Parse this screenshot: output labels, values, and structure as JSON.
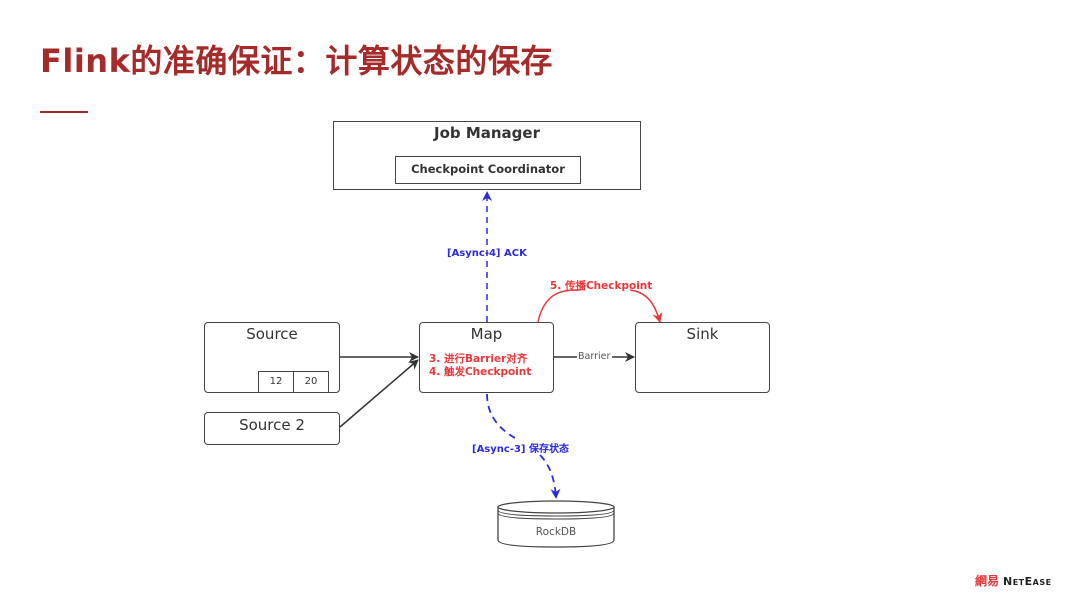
{
  "slide": {
    "title": "Flink的准确保证：计算状态的保存"
  },
  "diagram": {
    "job_manager": {
      "label": "Job Manager",
      "inner": "Checkpoint Coordinator"
    },
    "source": {
      "label": "Source",
      "cells": [
        "12",
        "20"
      ]
    },
    "source2": {
      "label": "Source 2"
    },
    "map": {
      "label": "Map",
      "steps": [
        "3. 进行Barrier对齐",
        "4. 触发Checkpoint"
      ]
    },
    "sink": {
      "label": "Sink"
    },
    "rockdb": {
      "label": "RockDB"
    },
    "edges": {
      "ack": "[Async-4] ACK",
      "propagate": "5. 传播Checkpoint",
      "barrier": "Barrier",
      "save_state": "[Async-3] 保存状态"
    },
    "colors": {
      "title": "#a52a2a",
      "red": "#e8373a",
      "blue": "#2a2ae0",
      "border": "#444444"
    }
  },
  "footer": {
    "logo_cn": "網易",
    "logo_en": "NetEase"
  }
}
